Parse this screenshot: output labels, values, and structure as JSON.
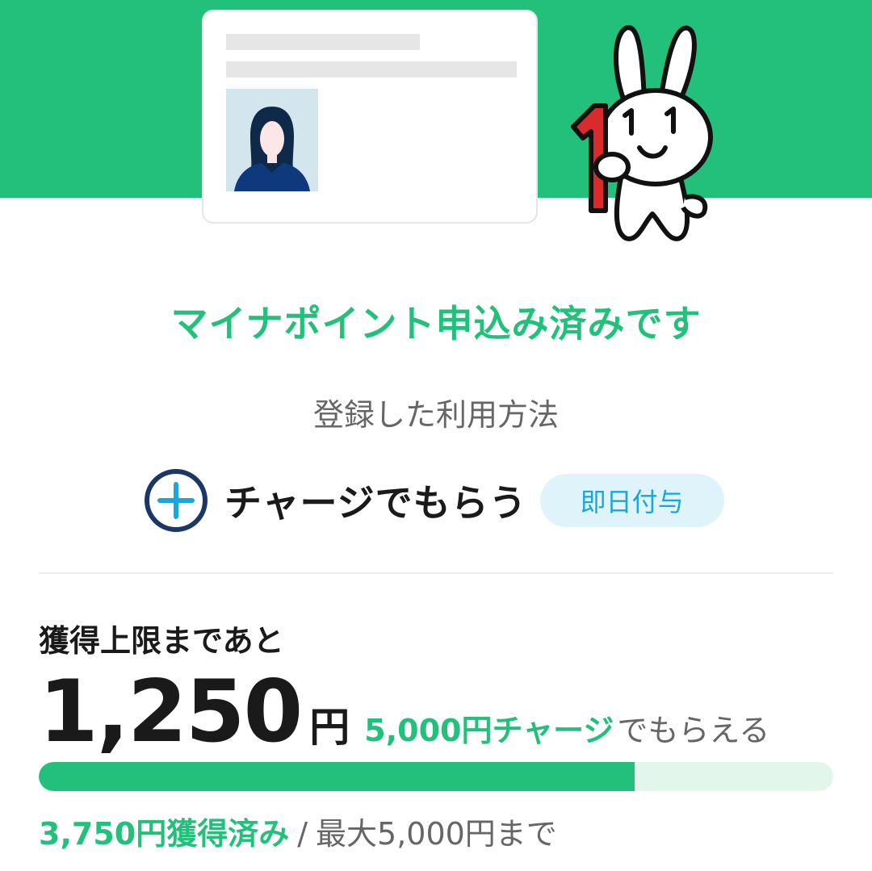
{
  "status": {
    "title": "マイナポイント申込み済みです",
    "subtitle": "登録した利用方法"
  },
  "method": {
    "label": "チャージでもらう",
    "badge": "即日付与"
  },
  "limit": {
    "label": "獲得上限まであと",
    "remaining_amount": "1,250",
    "currency": "円",
    "charge_text": "5,000円チャージ",
    "charge_suffix": "でもらえる",
    "progress_fraction": 0.75,
    "earned_text": "3,750円獲得済み",
    "separator": "/",
    "max_text": "最大5,000円まで"
  },
  "mascot": {
    "held_number": "1",
    "eye_marks": "1 1"
  },
  "colors": {
    "brand_green": "#22c07a",
    "badge_bg": "#dff3fb",
    "badge_text": "#1aa6dc",
    "icon_navy": "#1c3668"
  },
  "icons": {
    "plus": "plus-circle-icon",
    "card_photo": "person-avatar-icon"
  }
}
